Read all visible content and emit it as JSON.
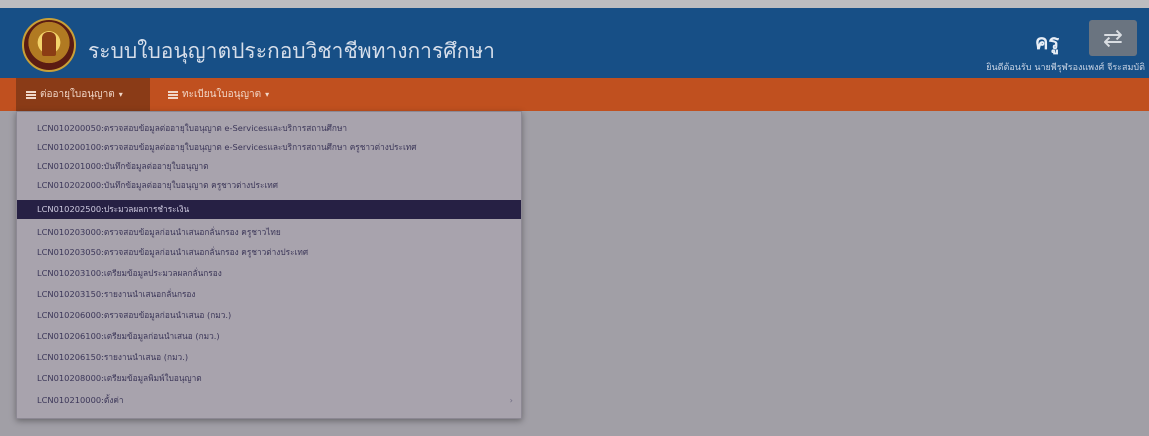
{
  "header": {
    "app_title": "ระบบใบอนุญาตประกอบวิชาชีพทางการศึกษา",
    "role": "ครู",
    "switch_icon": "swap-arrows-icon",
    "welcome": "ยินดีต้อนรับ นายพีรุฬรองแพงศ์ จีระสมบัติ"
  },
  "nav": {
    "items": [
      {
        "label": "ต่ออายุใบอนุญาต",
        "icon": "list-icon"
      },
      {
        "label": "ทะเบียนใบอนุญาต",
        "icon": "list-icon"
      }
    ]
  },
  "menu": {
    "items": [
      "LCN010200050:ตรวจสอบข้อมูลต่ออายุใบอนุญาต e-Servicesและบริการสถานศึกษา",
      "LCN010200100:ตรวจสอบข้อมูลต่ออายุใบอนุญาต e-Servicesและบริการสถานศึกษา ครูชาวต่างประเทศ",
      "LCN010201000:บันทึกข้อมูลต่ออายุใบอนุญาต",
      "LCN010202000:บันทึกข้อมูลต่ออายุใบอนุญาต ครูชาวต่างประเทศ",
      "LCN010202500:ประมวลผลการชำระเงิน",
      "LCN010203000:ตรวจสอบข้อมูลก่อนนำเสนอกลั่นกรอง ครูชาวไทย",
      "LCN010203050:ตรวจสอบข้อมูลก่อนนำเสนอกลั่นกรอง ครูชาวต่างประเทศ",
      "LCN010203100:เตรียมข้อมูลประมวลผลกลั่นกรอง",
      "LCN010203150:รายงานนำเสนอกลั่นกรอง",
      "LCN010206000:ตรวจสอบข้อมูลก่อนนำเสนอ (กมว.)",
      "LCN010206100:เตรียมข้อมูลก่อนนำเสนอ (กมว.)",
      "LCN010206150:รายงานนำเสนอ (กมว.)",
      "LCN010208000:เตรียมข้อมูลพิมพ์ใบอนุญาต",
      "LCN010210000:ตั้งค่า"
    ],
    "selected_index": 4,
    "submenu_arrow": "›"
  }
}
